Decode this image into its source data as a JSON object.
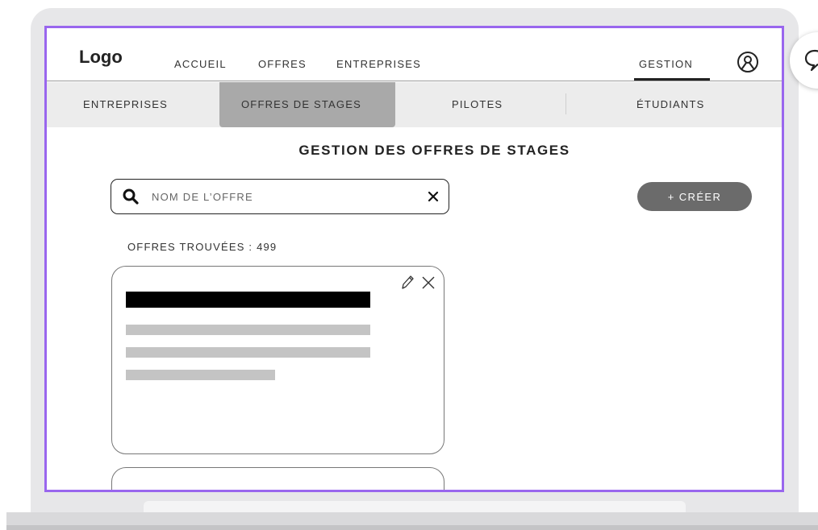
{
  "header": {
    "logo": "Logo",
    "nav": [
      "ACCUEIL",
      "OFFRES",
      "ENTREPRISES"
    ],
    "gestion_label": "GESTION",
    "user_icon": "user-circle-icon"
  },
  "subnav": {
    "items": [
      "ENTREPRISES",
      "OFFRES DE STAGES",
      "PILOTES",
      "ÉTUDIANTS"
    ],
    "active": "OFFRES DE STAGES"
  },
  "main": {
    "title": "GESTION DES OFFRES DE STAGES",
    "search": {
      "placeholder": "NOM DE L’OFFRE",
      "value": ""
    },
    "create_label": "+ CRÉER",
    "results_label": "OFFRES TROUVÉES : ",
    "results_count": "499"
  },
  "colors": {
    "frame_border": "#9966ee",
    "active_tab": "#a9a9a9",
    "create_button": "#6b6b6b"
  },
  "icons": {
    "search": "search-icon",
    "clear": "close-icon",
    "edit": "pencil-icon",
    "delete": "close-icon",
    "chat": "chat-bubble-icon"
  }
}
